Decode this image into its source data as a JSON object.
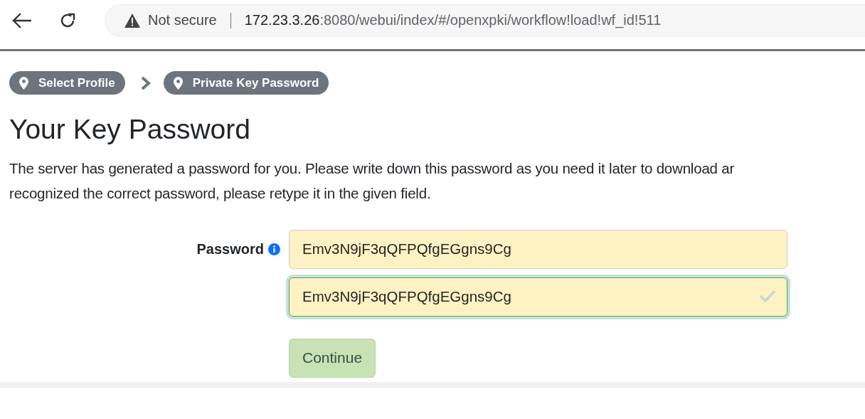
{
  "browser": {
    "security_label": "Not secure",
    "url_host": "172.23.3.26",
    "url_rest": ":8080/webui/index/#/openxpki/workflow!load!wf_id!511"
  },
  "breadcrumbs": [
    {
      "label": "Select Profile"
    },
    {
      "label": "Private Key Password"
    }
  ],
  "heading": "Your Key Password",
  "description": [
    "The server has generated a password for you. Please write down this password as you need it later to download ar",
    "recognized the correct password, please retype it in the given field."
  ],
  "form": {
    "label": "Password",
    "password_value": "Emv3N9jF3qQFPQfgEGgns9Cg",
    "confirm_value": "Emv3N9jF3qQFPQfgEGgns9Cg",
    "confirm_valid": true
  },
  "button": {
    "label": "Continue",
    "disabled": true
  }
}
